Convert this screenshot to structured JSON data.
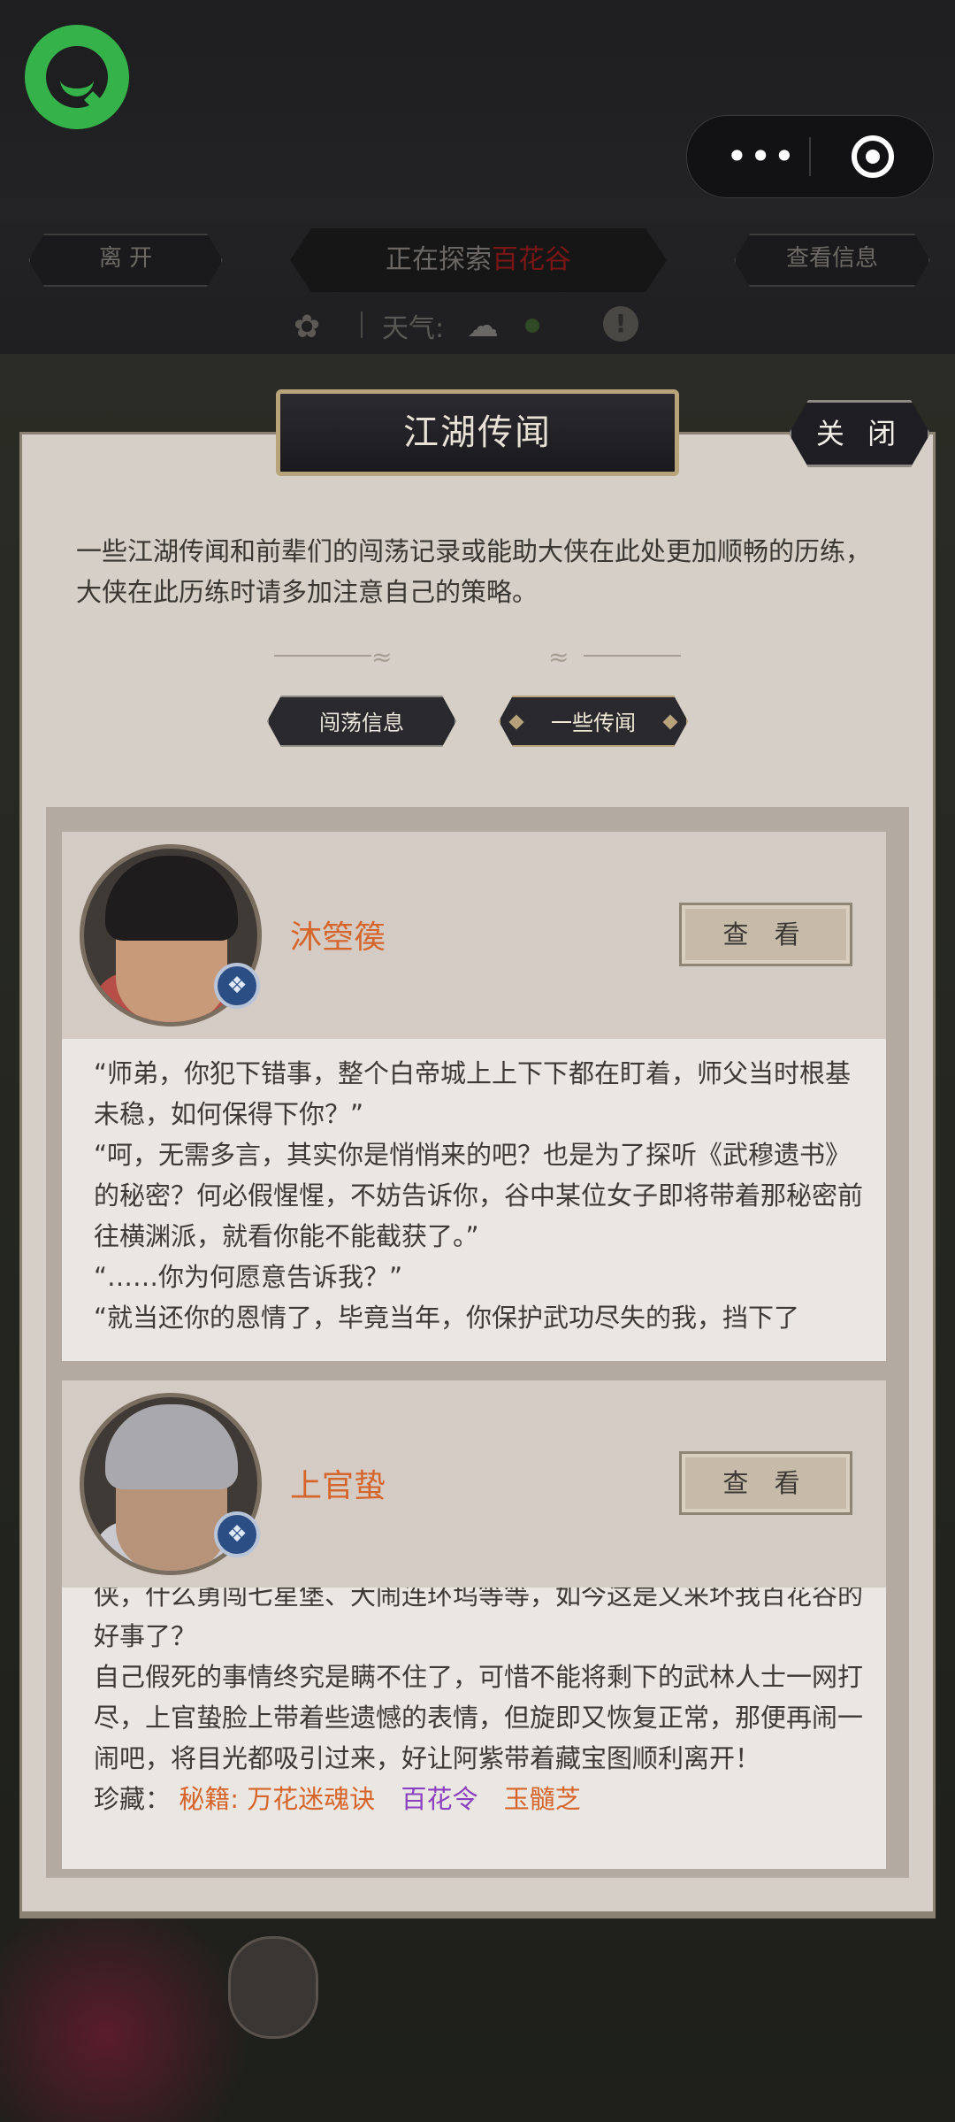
{
  "app": {
    "topbar": {
      "capsule_more": "•••"
    },
    "nav": {
      "leave_label": "离 开",
      "explore_prefix": "正在探索",
      "explore_place": "百花谷",
      "info_label": "查看信息"
    },
    "weather": {
      "label": "天气:",
      "warning": "!"
    }
  },
  "dialog": {
    "title": "江湖传闻",
    "close_label": "关 闭",
    "intro": "一些江湖传闻和前辈们的闯荡记录或能助大侠在此处更加顺畅的历练，大侠在此历练时请多加注意自己的策略。",
    "tabs": [
      {
        "label": "闯荡信息"
      },
      {
        "label": "一些传闻"
      }
    ],
    "cards": [
      {
        "name": "沐箜篌",
        "view_label": "查 看",
        "lines": [
          "“师弟，你犯下错事，整个白帝城上上下下都在盯着，师父当时根基未稳，如何保得下你？”",
          "“呵，无需多言，其实你是悄悄来的吧？也是为了探听《武穆遗书》的秘密？何必假惺惺，不妨告诉你，谷中某位女子即将带着那秘密前往横渊派，就看你能不能截获了。”",
          "“……你为何愿意告诉我？”",
          "“就当还你的恩情了，毕竟当年，你保护武功尽失的我，挡下了"
        ]
      },
      {
        "name": "上官蛰",
        "view_label": "查 看",
        "lines": [
          "侠，什么勇闯七星堡、大闹连环坞等等，如今这是又来坏我百花谷的好事了？",
          "自己假死的事情终究是瞒不住了，可惜不能将剩下的武林人士一网打尽，上官蛰脸上带着些遗憾的表情，但旋即又恢复正常，那便再闹一闹吧，将目光都吸引过来，好让阿紫带着藏宝图顺利离开！"
        ],
        "treasure_label": "珍藏：",
        "treasure_items": [
          "秘籍: 万花迷魂诀",
          "百花令",
          "玉髓芝"
        ]
      }
    ]
  }
}
